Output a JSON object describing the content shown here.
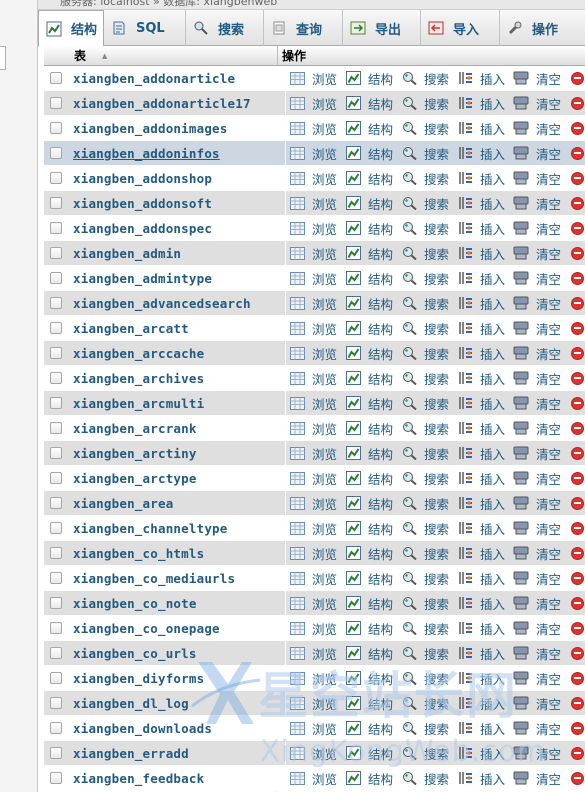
{
  "breadcrumb": "服务器: localhost » 数据库: xiangbenweb",
  "tabs": [
    {
      "label": "结构",
      "icon": "structure-icon",
      "active": true
    },
    {
      "label": "SQL",
      "icon": "sql-icon"
    },
    {
      "label": "搜索",
      "icon": "search-icon"
    },
    {
      "label": "查询",
      "icon": "query-icon"
    },
    {
      "label": "导出",
      "icon": "export-icon"
    },
    {
      "label": "导入",
      "icon": "import-icon"
    },
    {
      "label": "操作",
      "icon": "operations-icon"
    }
  ],
  "table_header": {
    "table": "表",
    "operations": "操作"
  },
  "actions": {
    "browse": "浏览",
    "structure": "结构",
    "search": "搜索",
    "insert": "插入",
    "empty": "清空"
  },
  "rows": [
    "xiangben_addonarticle",
    "xiangben_addonarticle17",
    "xiangben_addonimages",
    "xiangben_addoninfos",
    "xiangben_addonshop",
    "xiangben_addonsoft",
    "xiangben_addonspec",
    "xiangben_admin",
    "xiangben_admintype",
    "xiangben_advancedsearch",
    "xiangben_arcatt",
    "xiangben_arccache",
    "xiangben_archives",
    "xiangben_arcmulti",
    "xiangben_arcrank",
    "xiangben_arctiny",
    "xiangben_arctype",
    "xiangben_area",
    "xiangben_channeltype",
    "xiangben_co_htmls",
    "xiangben_co_mediaurls",
    "xiangben_co_note",
    "xiangben_co_onepage",
    "xiangben_co_urls",
    "xiangben_diyforms",
    "xiangben_dl_log",
    "xiangben_downloads",
    "xiangben_erradd",
    "xiangben_feedback"
  ],
  "highlighted_row": 3,
  "watermark": {
    "cn": "星空站长网",
    "en": "XingKongWeb.com"
  },
  "colors": {
    "link": "#235a81",
    "row_alt": "#dfdfdf",
    "row_highlight": "#cdd7e2",
    "drop": "#e0322d"
  }
}
